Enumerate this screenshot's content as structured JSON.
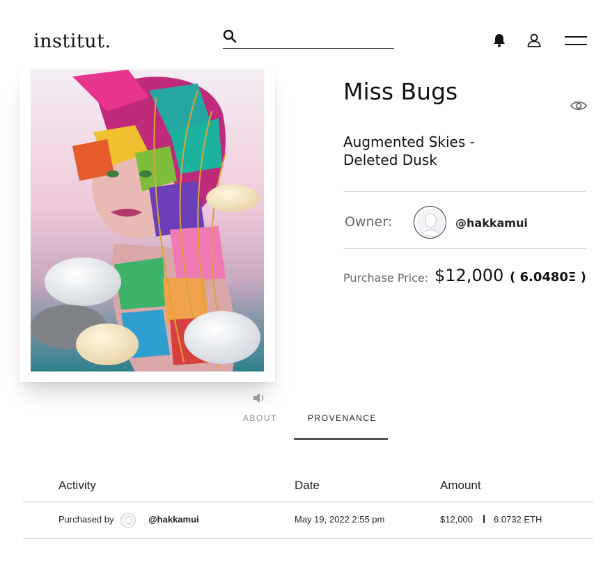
{
  "header": {
    "logo": "institut.",
    "search_placeholder": ""
  },
  "artwork": {
    "title": "Miss Bugs",
    "subtitle": "Augmented Skies - Deleted Dusk"
  },
  "owner": {
    "label": "Owner:",
    "handle": "@hakkamui"
  },
  "price": {
    "label": "Purchase Price:",
    "usd": "$12,000",
    "eth": "( 6.0480Ξ )"
  },
  "tabs": [
    {
      "label": "ABOUT",
      "active": false
    },
    {
      "label": "PROVENANCE",
      "active": true
    }
  ],
  "provenance": {
    "columns": [
      "Activity",
      "Date",
      "Amount"
    ],
    "rows": [
      {
        "activity": "Purchased by",
        "handle": "@hakkamui",
        "date": "May 19, 2022 2:55 pm",
        "usd": "$12,000",
        "eth": "6.0732 ETH"
      }
    ]
  },
  "icons": {
    "search": "search-icon",
    "bell": "bell-icon",
    "user": "user-icon",
    "menu": "menu-icon",
    "eye": "eye-icon",
    "sound": "speaker-icon"
  },
  "colors": {
    "text": "#111111",
    "muted": "#666666",
    "rule": "#cfcfcf"
  }
}
